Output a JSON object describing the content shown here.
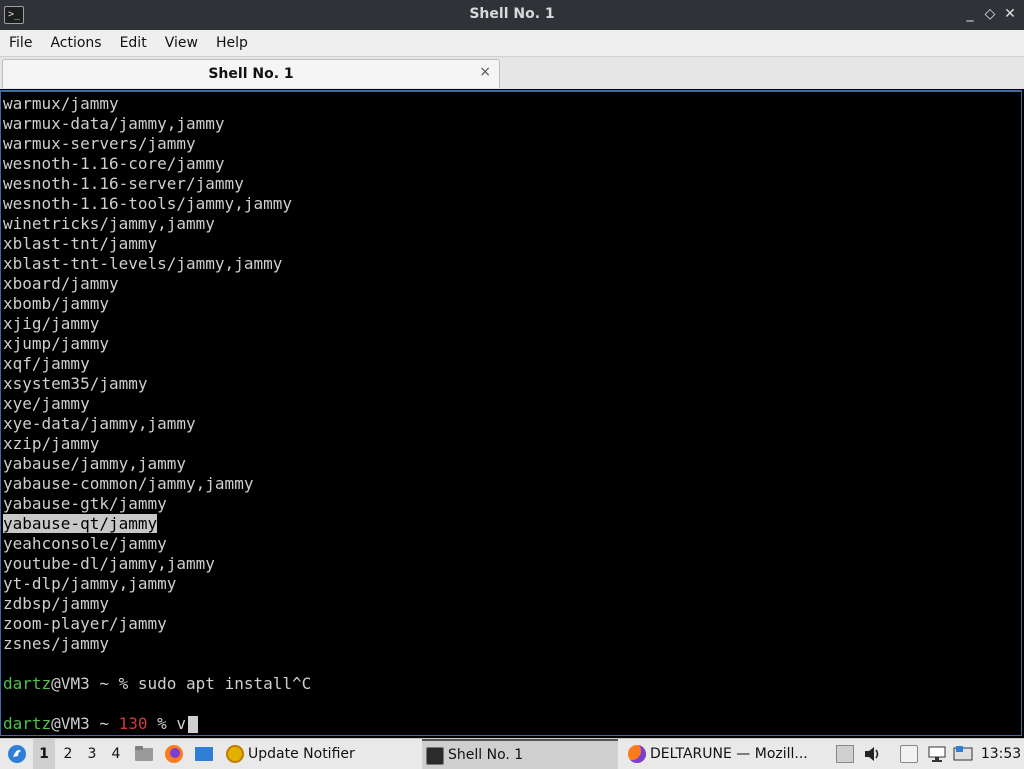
{
  "window": {
    "title": "Shell No. 1",
    "controls": {
      "minimize": "_",
      "maximize": "◇",
      "close": "✕"
    }
  },
  "menu": {
    "items": [
      "File",
      "Actions",
      "Edit",
      "View",
      "Help"
    ]
  },
  "tab": {
    "label": "Shell No. 1",
    "close": "×"
  },
  "terminal": {
    "lines": [
      "warmux/jammy",
      "warmux-data/jammy,jammy",
      "warmux-servers/jammy",
      "wesnoth-1.16-core/jammy",
      "wesnoth-1.16-server/jammy",
      "wesnoth-1.16-tools/jammy,jammy",
      "winetricks/jammy,jammy",
      "xblast-tnt/jammy",
      "xblast-tnt-levels/jammy,jammy",
      "xboard/jammy",
      "xbomb/jammy",
      "xjig/jammy",
      "xjump/jammy",
      "xqf/jammy",
      "xsystem35/jammy",
      "xye/jammy",
      "xye-data/jammy,jammy",
      "xzip/jammy",
      "yabause/jammy,jammy",
      "yabause-common/jammy,jammy",
      "yabause-gtk/jammy",
      "yabause-qt/jammy",
      "yeahconsole/jammy",
      "youtube-dl/jammy,jammy",
      "yt-dlp/jammy,jammy",
      "zdbsp/jammy",
      "zoom-player/jammy",
      "zsnes/jammy"
    ],
    "prompt1": {
      "user": "dartz",
      "rest": "@VM3 ~ % sudo apt install^C"
    },
    "prompt2": {
      "user": "dartz",
      "host": "@VM3 ~ ",
      "code": "130",
      "rest": " % v"
    }
  },
  "taskbar": {
    "workspaces": [
      "1",
      "2",
      "3",
      "4"
    ],
    "tasks": [
      {
        "label": "Update Notifier"
      },
      {
        "label": "Shell No. 1"
      },
      {
        "label": "DELTARUNE — Mozill..."
      }
    ],
    "clock": "13:53"
  },
  "colors": {
    "prompt_user": "#4fc14f",
    "exit_code": "#d03a3a",
    "accent": "#3a6ea5"
  }
}
